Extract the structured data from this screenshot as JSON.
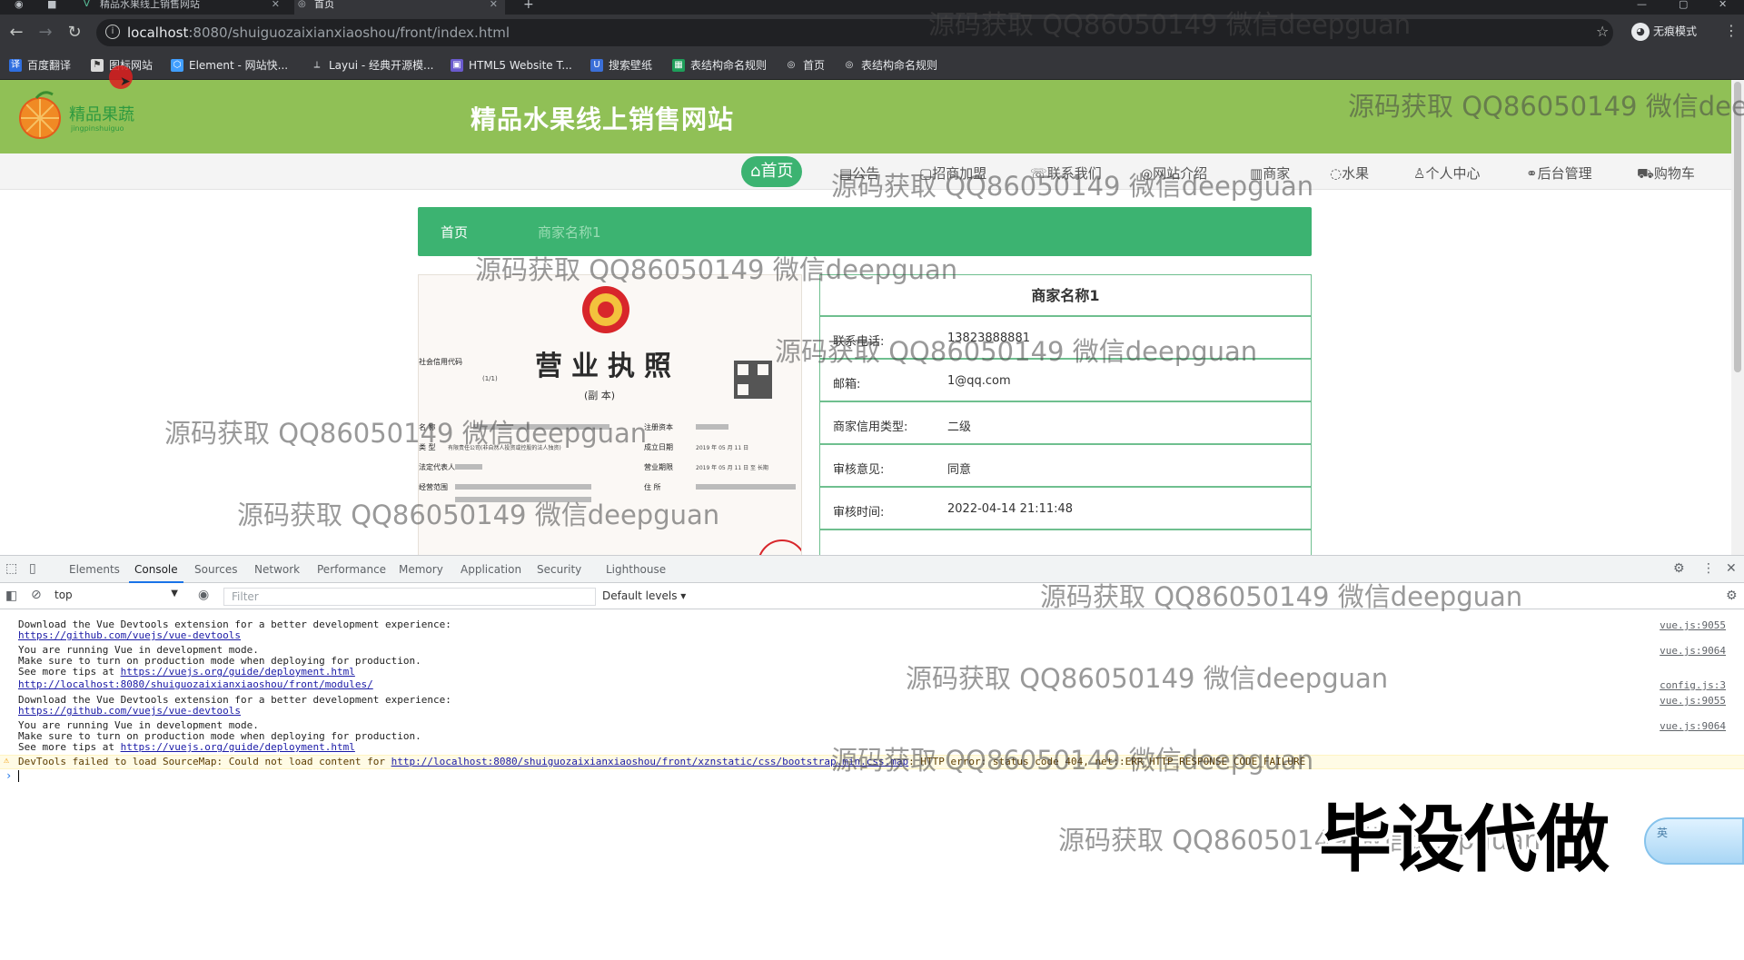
{
  "browser": {
    "tabs": [
      {
        "title": "精品水果线上销售网站",
        "active": false
      },
      {
        "title": "首页",
        "active": true
      }
    ],
    "url_host": "localhost",
    "url_path": ":8080/shuiguozaixianxiaoshou/front/index.html",
    "profile_label": "无痕模式",
    "bookmarks": [
      "百度翻译",
      "图标网站",
      "Element - 网站快...",
      "Layui - 经典开源模...",
      "HTML5 Website T...",
      "搜索壁纸",
      "表结构命名规则",
      "首页",
      "表结构命名规则"
    ]
  },
  "site": {
    "logo_text": "精品果蔬",
    "logo_sub": "jingpinshuiguo",
    "title": "精品水果线上销售网站",
    "nav": [
      {
        "icon": "⌂",
        "label": "首页"
      },
      {
        "icon": "▤",
        "label": "公告"
      },
      {
        "icon": "▢",
        "label": "招商加盟"
      },
      {
        "icon": "☏",
        "label": "联系我们"
      },
      {
        "icon": "◎",
        "label": "网站介绍"
      },
      {
        "icon": "▥",
        "label": "商家"
      },
      {
        "icon": "◌",
        "label": "水果"
      },
      {
        "icon": "♙",
        "label": "个人中心"
      },
      {
        "icon": "⚭",
        "label": "后台管理"
      },
      {
        "icon": "⛟",
        "label": "购物车"
      }
    ],
    "breadcrumb": {
      "home": "首页",
      "current": "商家名称1"
    },
    "license": {
      "title": "营业执照",
      "copy": "(副 本)",
      "credit_code_label": "社会信用代码",
      "page": "(1/1)",
      "fields_left": [
        "名  称",
        "类  型",
        "法定代表人",
        "经营范围"
      ],
      "fields_right": [
        "注册资本",
        "成立日期",
        "营业期限",
        "住  所"
      ],
      "type_value": "有限责任公司(非自然人投资或控股的法人独资)",
      "date_value": "2019 年 05 月 11 日",
      "term_value": "2019 年 05 月 11 日 至 长期"
    },
    "merchant": {
      "name": "商家名称1",
      "rows": [
        {
          "key": "联系电话:",
          "value": "13823888881"
        },
        {
          "key": "邮箱:",
          "value": "1@qq.com"
        },
        {
          "key": "商家信用类型:",
          "value": "二级"
        },
        {
          "key": "审核意见:",
          "value": "同意"
        },
        {
          "key": "审核时间:",
          "value": "2022-04-14 21:11:48"
        }
      ]
    }
  },
  "devtools": {
    "tabs": [
      "Elements",
      "Console",
      "Sources",
      "Network",
      "Performance",
      "Memory",
      "Application",
      "Security",
      "Lighthouse"
    ],
    "active_tab": "Console",
    "context": "top",
    "filter_placeholder": "Filter",
    "levels": "Default levels ▾",
    "messages": [
      {
        "lines": [
          "Download the Vue Devtools extension for a better development experience:"
        ],
        "link": "https://github.com/vuejs/vue-devtools",
        "source": "vue.js:9055"
      },
      {
        "lines": [
          "You are running Vue in development mode.",
          "Make sure to turn on production mode when deploying for production."
        ],
        "tip_prefix": "See more tips at ",
        "link": "https://vuejs.org/guide/deployment.html",
        "source": "vue.js:9064"
      },
      {
        "lines": [],
        "link": "http://localhost:8080/shuiguozaixianxiaoshou/front/modules/",
        "source": "config.js:3"
      },
      {
        "lines": [
          "Download the Vue Devtools extension for a better development experience:"
        ],
        "link": "https://github.com/vuejs/vue-devtools",
        "source": "vue.js:9055"
      },
      {
        "lines": [
          "You are running Vue in development mode.",
          "Make sure to turn on production mode when deploying for production."
        ],
        "tip_prefix": "See more tips at ",
        "link": "https://vuejs.org/guide/deployment.html",
        "source": "vue.js:9064"
      }
    ],
    "warning": {
      "prefix": "DevTools failed to load SourceMap: Could not load content for ",
      "link": "http://localhost:8080/shuiguozaixianxiaoshou/front/xznstatic/css/bootstrap.min.css.map",
      "suffix": ": HTTP error: status code 404, net::ERR_HTTP_RESPONSE_CODE_FAILURE"
    }
  },
  "overlay": {
    "watermark": "源码获取 QQ86050149 微信deepguan",
    "big_text": "毕设代做",
    "pet_label": "英"
  }
}
